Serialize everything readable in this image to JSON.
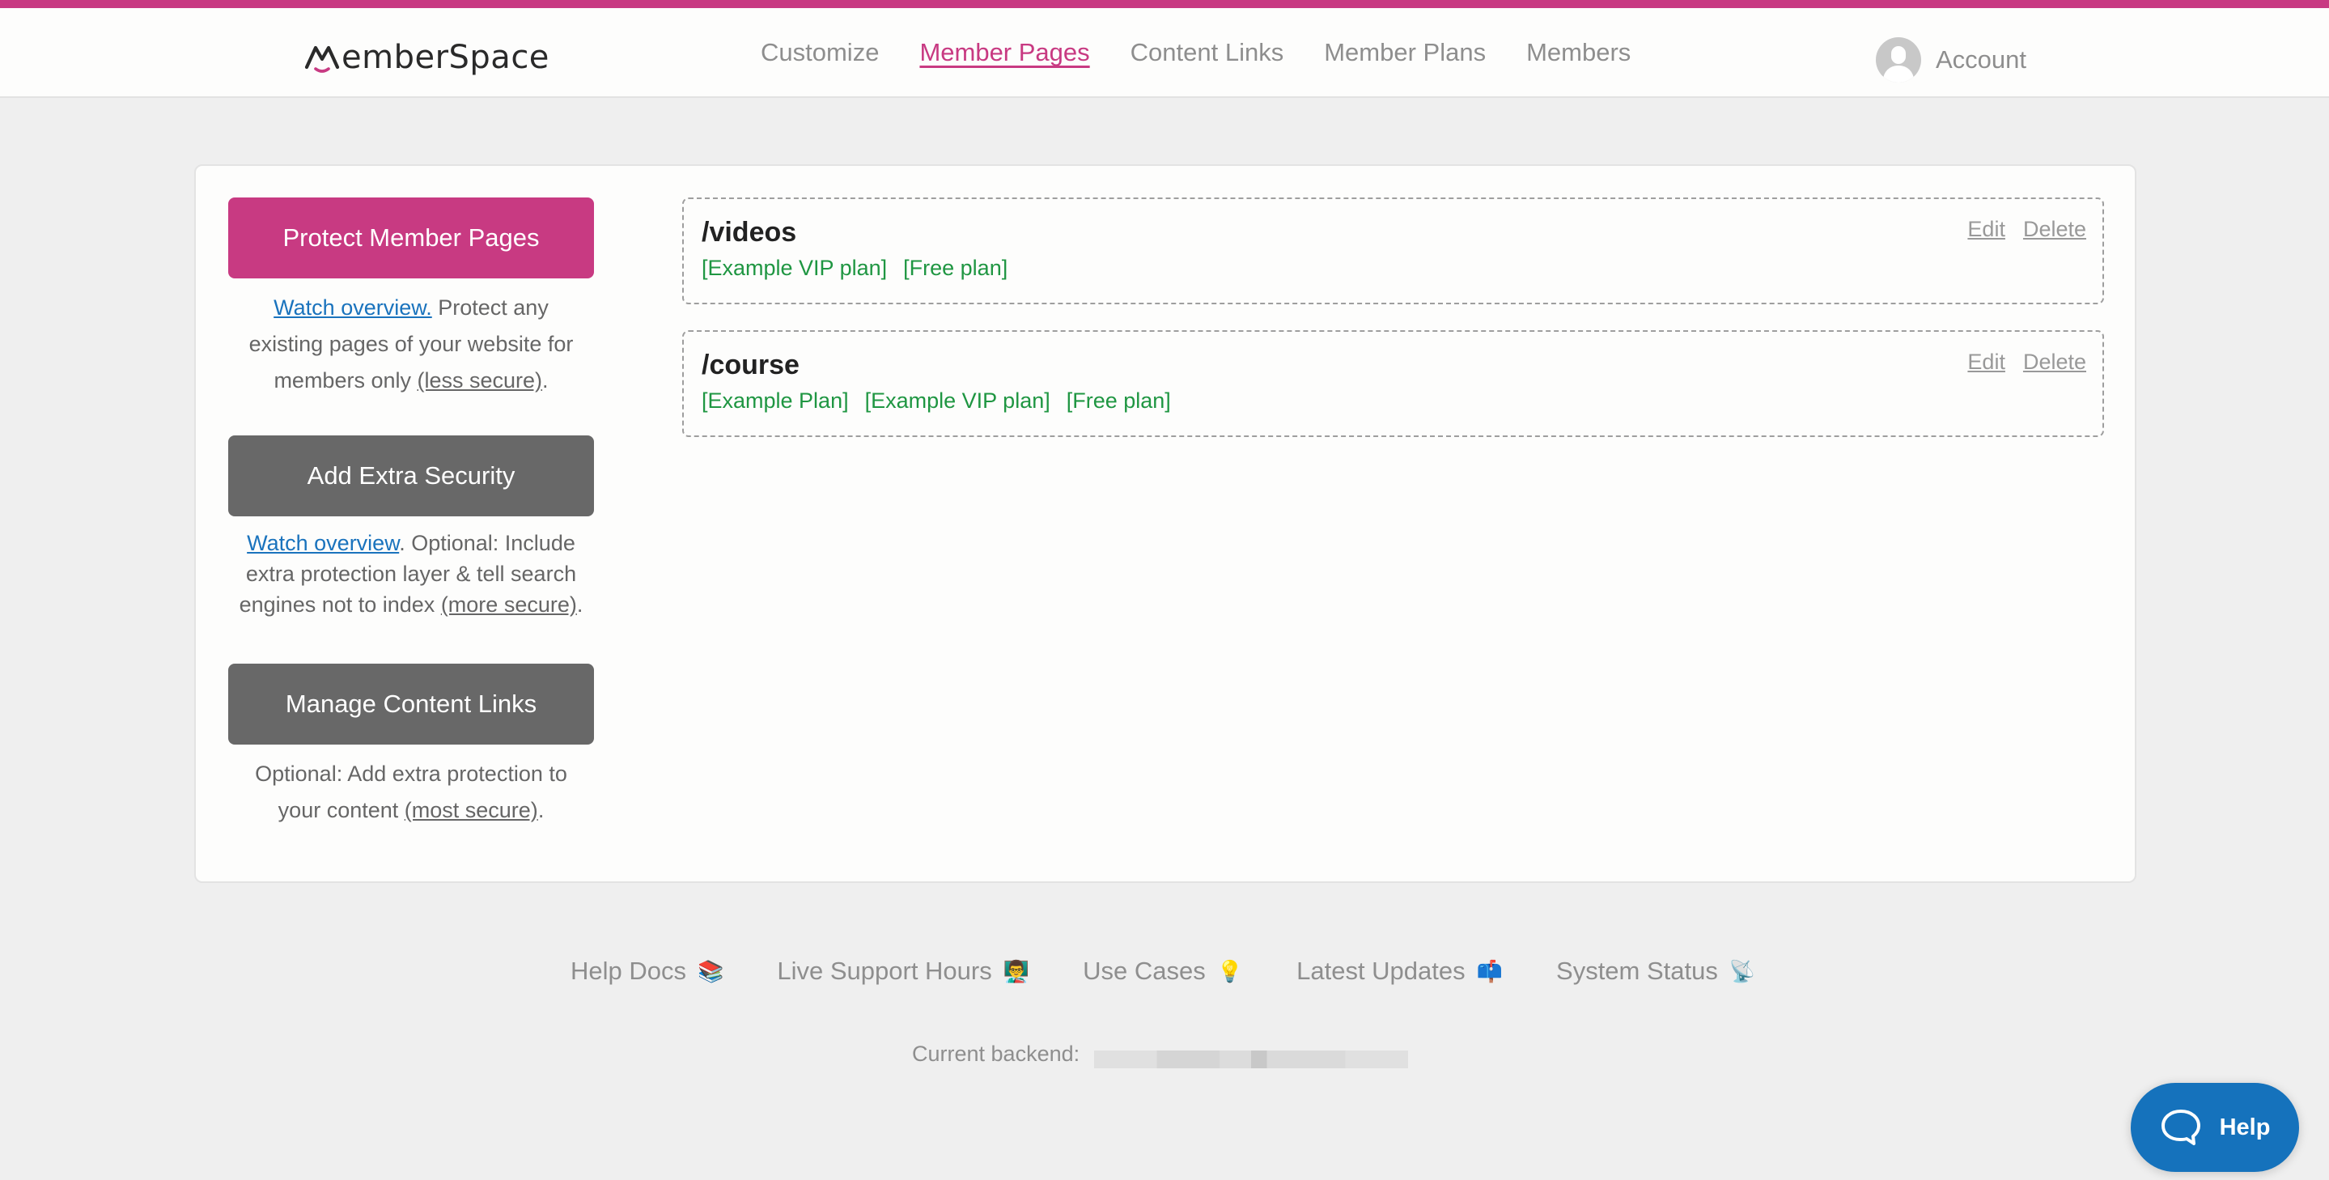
{
  "brand": {
    "name": "MemberSpace",
    "accent_color": "#C83A82",
    "plan_tag_color": "#1F9642",
    "link_color": "#1A73BD",
    "help_color": "#1572BC"
  },
  "nav": {
    "items": [
      {
        "label": "Customize",
        "active": false
      },
      {
        "label": "Member Pages",
        "active": true
      },
      {
        "label": "Content Links",
        "active": false
      },
      {
        "label": "Member Plans",
        "active": false
      },
      {
        "label": "Members",
        "active": false
      }
    ],
    "account_label": "Account",
    "account_icon": "user-avatar-icon"
  },
  "actions": [
    {
      "button_label": "Protect Member Pages",
      "watch_link": "Watch overview.",
      "text_before_security": " Protect any existing pages of your website for members only ",
      "security_link": "(less secure)",
      "text_end": "."
    },
    {
      "button_label": "Add Extra Security",
      "watch_link": "Watch overview",
      "text_before_security": ". Optional: Include extra protection layer & tell search engines not to index ",
      "security_link": "(more secure)",
      "text_end": "."
    },
    {
      "button_label": "Manage Content Links",
      "text_before_security": "Optional: Add extra protection to your content ",
      "security_link": "(most secure)",
      "text_end": "."
    }
  ],
  "pages": [
    {
      "path": "/videos",
      "plans": [
        "[Example VIP plan]",
        "[Free plan]"
      ],
      "edit_label": "Edit",
      "delete_label": "Delete"
    },
    {
      "path": "/course",
      "plans": [
        "[Example Plan]",
        "[Example VIP plan]",
        "[Free plan]"
      ],
      "edit_label": "Edit",
      "delete_label": "Delete"
    }
  ],
  "footer": {
    "links": [
      {
        "label": "Help Docs",
        "emoji": "📚",
        "icon": "books-icon"
      },
      {
        "label": "Live Support Hours",
        "emoji": "👨‍🏫",
        "icon": "teacher-icon"
      },
      {
        "label": "Use Cases",
        "emoji": "💡",
        "icon": "lightbulb-icon"
      },
      {
        "label": "Latest Updates",
        "emoji": "📫",
        "icon": "mailbox-icon"
      },
      {
        "label": "System Status",
        "emoji": "📡",
        "icon": "satellite-dish-icon"
      }
    ],
    "backend_label": "Current backend:",
    "backend_value_redacted": true
  },
  "help_widget": {
    "label": "Help",
    "icon": "chat-bubble-icon"
  }
}
